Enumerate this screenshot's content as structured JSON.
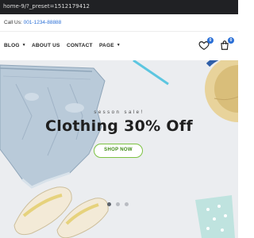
{
  "browser": {
    "url": "home-9/?_preset=1512179412"
  },
  "topbar": {
    "call_label": "Call Us:",
    "phone": "001-1234-88888"
  },
  "nav": {
    "items": [
      {
        "label": "BLOG",
        "has_dropdown": true
      },
      {
        "label": "ABOUT US",
        "has_dropdown": false
      },
      {
        "label": "CONTACT",
        "has_dropdown": false
      },
      {
        "label": "PAGE",
        "has_dropdown": true
      }
    ],
    "wishlist_count": "0",
    "cart_count": "0",
    "icons": [
      "heart-icon",
      "cart-icon"
    ]
  },
  "hero": {
    "subtitle": "sesson sale!",
    "title": "Clothing 30% Off",
    "button_label": "SHOP NOW",
    "slides_total": 3,
    "active_slide": 1
  },
  "colors": {
    "accent": "#2a6fd6",
    "button_border": "#7cc242",
    "hero_bg": "#ebedf0"
  }
}
